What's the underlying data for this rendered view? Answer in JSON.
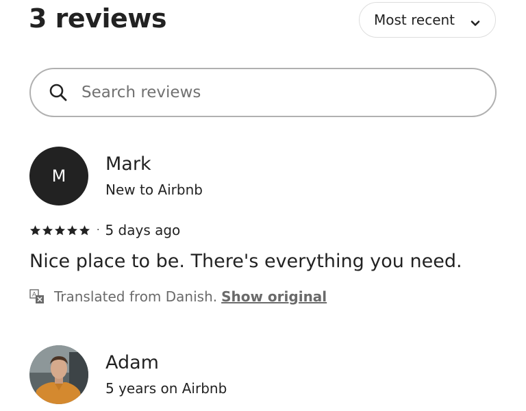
{
  "header": {
    "title": "3 reviews",
    "sort_label": "Most recent",
    "sort_icon": "chevron-down-icon"
  },
  "search": {
    "placeholder": "Search reviews",
    "value": "",
    "icon": "search-icon"
  },
  "reviews": [
    {
      "name": "Mark",
      "avatar_initial": "M",
      "subtitle": "New to Airbnb",
      "rating": 5,
      "date": "5 days ago",
      "text": "Nice place to be. There's everything you need.",
      "translation_note": "Translated from Danish.",
      "translation_link": "Show original"
    },
    {
      "name": "Adam",
      "avatar_type": "photo",
      "subtitle": "5 years on Airbnb"
    }
  ],
  "colors": {
    "text": "#222222",
    "muted": "#6a6a6a",
    "border": "#b0b0b0",
    "avatar_bg": "#222222"
  }
}
